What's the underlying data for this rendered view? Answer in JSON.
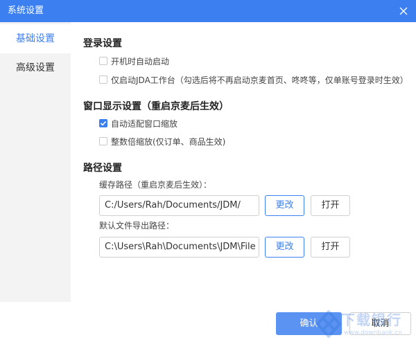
{
  "window": {
    "title": "系统设置"
  },
  "sidebar": {
    "items": [
      {
        "label": "基础设置",
        "active": true
      },
      {
        "label": "高级设置",
        "active": false
      }
    ]
  },
  "login": {
    "title": "登录设置",
    "options": [
      {
        "label": "开机时自动启动",
        "checked": false
      },
      {
        "label": "仅启动JDA工作台（勾选后将不再启动京麦首页、咚咚等，仅单账号登录时生效）",
        "checked": false
      }
    ]
  },
  "display": {
    "title": "窗口显示设置（重启京麦后生效）",
    "options": [
      {
        "label": "自动适配窗口缩放",
        "checked": true
      },
      {
        "label": "整数倍缩放(仅订单、商品生效)",
        "checked": false
      }
    ]
  },
  "paths": {
    "title": "路径设置",
    "cache": {
      "label": "缓存路径（重启京麦后生效）：",
      "value": "C:/Users/Rah/Documents/JDM/",
      "change_label": "更改",
      "open_label": "打开"
    },
    "export": {
      "label": "默认文件导出路径：",
      "value": "C:\\Users\\Rah\\Documents\\JDM\\File",
      "change_label": "更改",
      "open_label": "打开"
    }
  },
  "footer": {
    "ok_label": "确认",
    "cancel_label": "取消"
  },
  "watermark": {
    "name": "下载银行",
    "url": "www.downbank.cn"
  },
  "colors": {
    "accent": "#3b7ff0",
    "sidebar_bg": "#f3f3f3"
  }
}
